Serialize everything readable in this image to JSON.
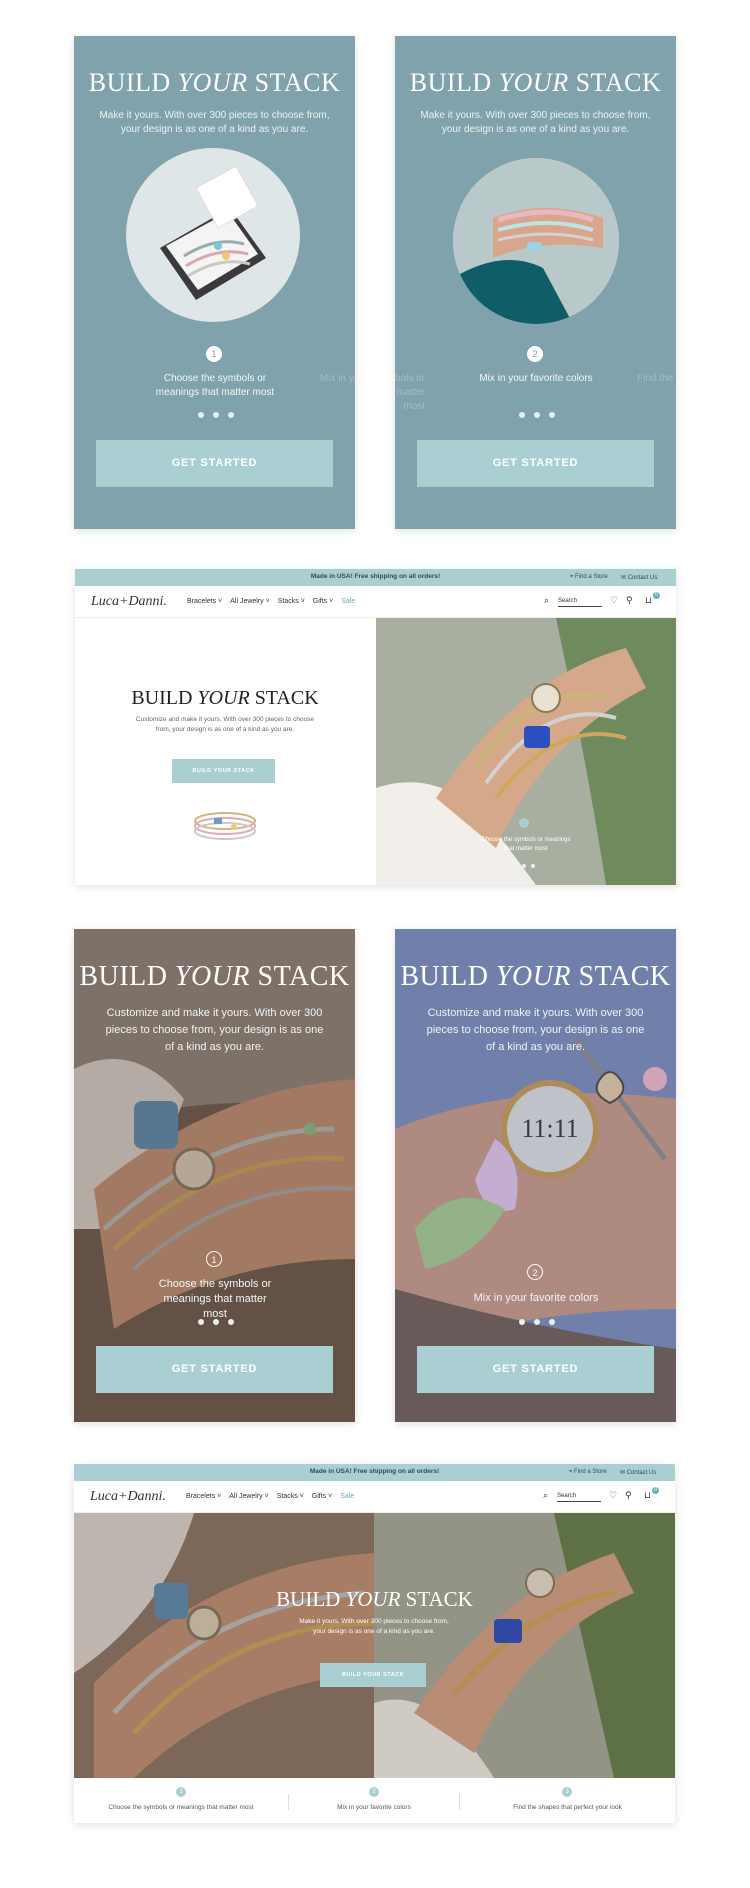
{
  "common": {
    "heading_pre": "BUILD ",
    "heading_em": "YOUR",
    "heading_post": " STACK",
    "cta": "GET STARTED",
    "desktop_cta": "BUILD YOUR STACK"
  },
  "mobile_1": {
    "subtitle": "Make it yours. With over 300 pieces to choose from, your design is as one of a kind as you are.",
    "step_number": "1",
    "step_text": "Choose the symbols or meanings that matter most",
    "ghost_text": "Mix in yo",
    "progress_dots": 3
  },
  "mobile_2": {
    "subtitle": "Make it yours. With over 300 pieces to choose from, your design is as one of a kind as you are.",
    "step_number": "2",
    "step_text": "Mix in your favorite colors",
    "ghost_left": "bols or at matter most",
    "ghost_right": "Find the",
    "progress_dots": 3
  },
  "desktop_1": {
    "announcement": "Made in USA! Free shipping on all orders!",
    "find_store": "Find a Store",
    "contact": "Contact Us",
    "logo": "Luca+Danni.",
    "nav": [
      "Bracelets",
      "All Jewelry",
      "Stacks",
      "Gifts"
    ],
    "sale": "Sale",
    "search_placeholder": "Search",
    "cart_count": "0",
    "subtitle": "Customize and make it yours. With over 300 pieces to choose from, your design is as one of a kind as you are.",
    "overlay_step_text": "Choose the symbols or meanings that matter most"
  },
  "mobile_3": {
    "subtitle": "Customize and make it yours. With over 300 pieces to choose from, your design is as one of a kind as you are.",
    "step_number": "1",
    "step_text": "Choose the symbols or meanings that matter most"
  },
  "mobile_4": {
    "subtitle": "Customize and make it yours. With over 300 pieces to choose from, your design is as one of a kind as you are.",
    "step_number": "2",
    "step_text": "Mix in your favorite colors"
  },
  "desktop_2": {
    "announcement": "Made in USA! Free shipping on all orders!",
    "find_store": "Find a Store",
    "contact": "Contact Us",
    "logo": "Luca+Danni.",
    "nav": [
      "Bracelets",
      "All Jewelry",
      "Stacks",
      "Gifts"
    ],
    "sale": "Sale",
    "search_placeholder": "Search",
    "cart_count": "0",
    "subtitle": "Make it yours. With over 300 pieces to choose from, your design is as one of a kind as you are.",
    "steps": [
      {
        "num": "1",
        "text": "Choose the symbols or meanings that matter most"
      },
      {
        "num": "2",
        "text": "Mix in your favorite colors"
      },
      {
        "num": "3",
        "text": "Find the shapes that perfect your look"
      }
    ]
  },
  "colors": {
    "slate_teal": "#7fa2ac",
    "button_teal": "#a9cfd2",
    "sale_accent": "#5fb0b8"
  }
}
